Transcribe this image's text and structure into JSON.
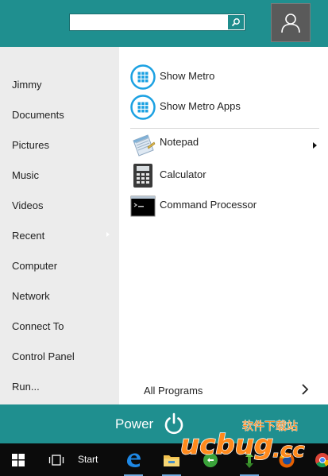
{
  "search": {
    "value": "",
    "placeholder": ""
  },
  "icons": {
    "search": "search-icon",
    "user": "user-icon",
    "power": "power-icon",
    "windows": "windows-logo-icon",
    "task_view": "task-view-icon",
    "edge": "edge-icon",
    "explorer": "file-explorer-icon"
  },
  "left_menu": {
    "items": [
      {
        "label": "Jimmy"
      },
      {
        "label": "Documents"
      },
      {
        "label": "Pictures"
      },
      {
        "label": "Music"
      },
      {
        "label": "Videos"
      },
      {
        "label": "Recent"
      },
      {
        "label": "Computer"
      },
      {
        "label": "Network"
      },
      {
        "label": "Connect To"
      },
      {
        "label": "Control Panel"
      },
      {
        "label": "Run..."
      }
    ]
  },
  "programs": {
    "pinned": [
      {
        "label": "Show Metro",
        "icon": "metro-grid-icon"
      },
      {
        "label": "Show Metro Apps",
        "icon": "metro-grid-icon"
      }
    ],
    "recent": [
      {
        "label": "Notepad",
        "icon": "notepad-icon"
      },
      {
        "label": "Calculator",
        "icon": "calculator-icon"
      },
      {
        "label": "Command Processor",
        "icon": "command-prompt-icon"
      }
    ],
    "all_programs_label": "All Programs"
  },
  "power": {
    "label": "Power"
  },
  "taskbar": {
    "start_label": "Start"
  },
  "watermark": {
    "text": "ucbug.cc 软件下载站"
  },
  "colors": {
    "accent": "#1f8f8f",
    "left_panel": "#ececec",
    "taskbar": "#0b0b0b",
    "metro_blue": "#1ba1e2"
  }
}
